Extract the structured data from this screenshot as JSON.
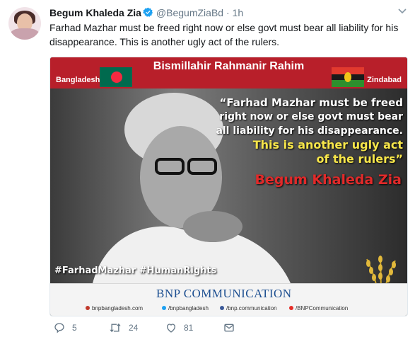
{
  "author": {
    "name": "Begum Khaleda Zia",
    "handle": "@BegumZiaBd",
    "separator": "·",
    "time": "1h"
  },
  "tweet_text": "Farhad Mazhar must be freed right now or else govt must bear all liability for his disappearance. This is another ugly act of the rulers.",
  "media": {
    "banner_title": "Bismillahir Rahmanir Rahim",
    "banner_left": "Bangladesh",
    "banner_right": "Zindabad",
    "quote_line1": "“Farhad Mazhar must be freed",
    "quote_line2": "right now or else govt must bear",
    "quote_line3": "all liability for his disappearance.",
    "quote_line4": "This is another ugly act",
    "quote_line5": "of the rulers”",
    "quote_attribution": "Begum Khaleda Zia",
    "hashtags": "#FarhadMazhar #HumanRights",
    "footer_title": "BNP COMMUNICATION",
    "footer_links": {
      "website": "bnpbangladesh.com",
      "twitter": "/bnpbangladesh",
      "facebook": "/bnp.communication",
      "youtube": "/BNPCommunication"
    }
  },
  "actions": {
    "replies": "5",
    "retweets": "24",
    "likes": "81"
  },
  "colors": {
    "banner_red": "#b81f2a",
    "verified_blue": "#1da1f2",
    "quote_yellow": "#f7e64a",
    "attribution_red": "#e02a2a",
    "footer_blue": "#1d4f91"
  },
  "icons": [
    "verified-badge-icon",
    "chevron-down-icon",
    "reply-icon",
    "retweet-icon",
    "like-icon",
    "direct-message-icon"
  ]
}
